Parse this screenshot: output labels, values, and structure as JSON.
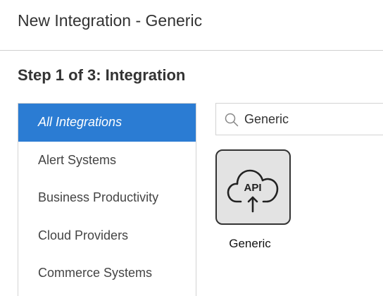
{
  "header": {
    "title": "New Integration - Generic"
  },
  "step": {
    "title": "Step 1 of 3: Integration"
  },
  "categories": [
    {
      "label": "All Integrations",
      "active": true
    },
    {
      "label": "Alert Systems",
      "active": false
    },
    {
      "label": "Business Productivity",
      "active": false
    },
    {
      "label": "Cloud Providers",
      "active": false
    },
    {
      "label": "Commerce Systems",
      "active": false
    }
  ],
  "search": {
    "value": "Generic",
    "icon": "search-icon"
  },
  "results": [
    {
      "label": "Generic",
      "icon_text": "API",
      "icon": "cloud-upload-api-icon"
    }
  ],
  "colors": {
    "active": "#2b7cd3",
    "tile_bg": "#e3e3e3",
    "border": "#d3d3d3"
  }
}
